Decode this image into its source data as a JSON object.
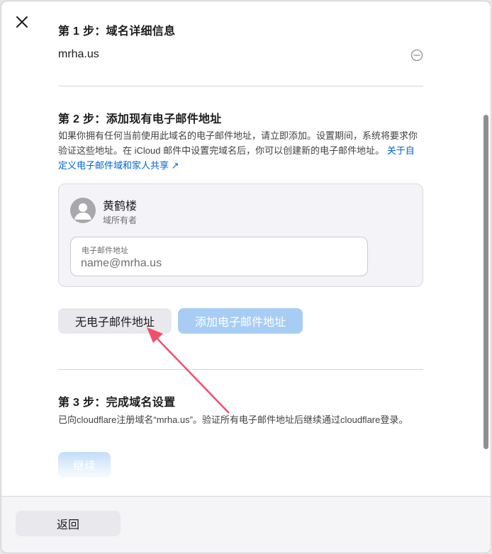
{
  "step1": {
    "title": "第 1 步：域名详细信息",
    "domain": "mrha.us"
  },
  "step2": {
    "title": "第 2 步：添加现有电子邮件地址",
    "description": "如果你拥有任何当前使用此域名的电子邮件地址，请立即添加。设置期间，系统将要求你验证这些地址。在 iCloud 邮件中设置完域名后，你可以创建新的电子邮件地址。",
    "link": "关于自定义电子邮件域和家人共享 ↗",
    "owner_name": "黄鹤楼",
    "owner_role": "域所有者",
    "email_label": "电子邮件地址",
    "email_placeholder": "name@mrha.us",
    "email_value": "",
    "no_email_button": "无电子邮件地址",
    "add_email_button": "添加电子邮件地址"
  },
  "step3": {
    "title": "第 3 步：完成域名设置",
    "description": "已向cloudflare注册域名“mrha.us”。验证所有电子邮件地址后继续通过cloudflare登录。",
    "continue_button": "继续"
  },
  "footer": {
    "back_button": "返回"
  },
  "colors": {
    "accent": "#0071e3",
    "link": "#0066cc",
    "disabled_primary": "#a8cdf5",
    "annotation_arrow": "#f0506e"
  },
  "icons": {
    "close": "close-icon",
    "collapse": "minus-circle-icon",
    "avatar": "person-icon"
  }
}
